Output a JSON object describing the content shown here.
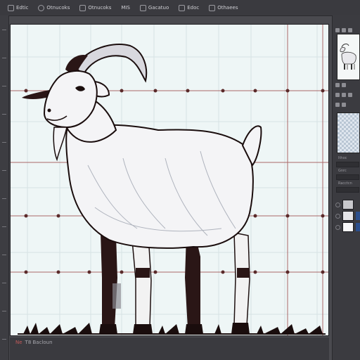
{
  "menu": {
    "items": [
      {
        "icon": "file-icon",
        "label": "Edtic"
      },
      {
        "icon": "circle-icon",
        "label": "Otnucoks"
      },
      {
        "icon": "picture-icon",
        "label": "Otnucoks"
      },
      {
        "icon": "",
        "label": "MIS"
      },
      {
        "icon": "brush-icon",
        "label": "Gacatuo"
      },
      {
        "icon": "square-icon",
        "label": "Edoc"
      },
      {
        "icon": "layers-icon",
        "label": "Othaees"
      }
    ]
  },
  "right_panel": {
    "labels": [
      "Ithoc",
      "Gnrc",
      "Racctcn"
    ]
  },
  "status": {
    "position": "Ne",
    "zoom": "T8 Bacloun"
  },
  "colors": {
    "canvas_bg": "#eef6f6",
    "guide_line": "#8a3232",
    "layer_accent": "#2c4f8c"
  },
  "image": {
    "subject": "goat illustration on a guide grid",
    "guide_dots": "dark red"
  }
}
